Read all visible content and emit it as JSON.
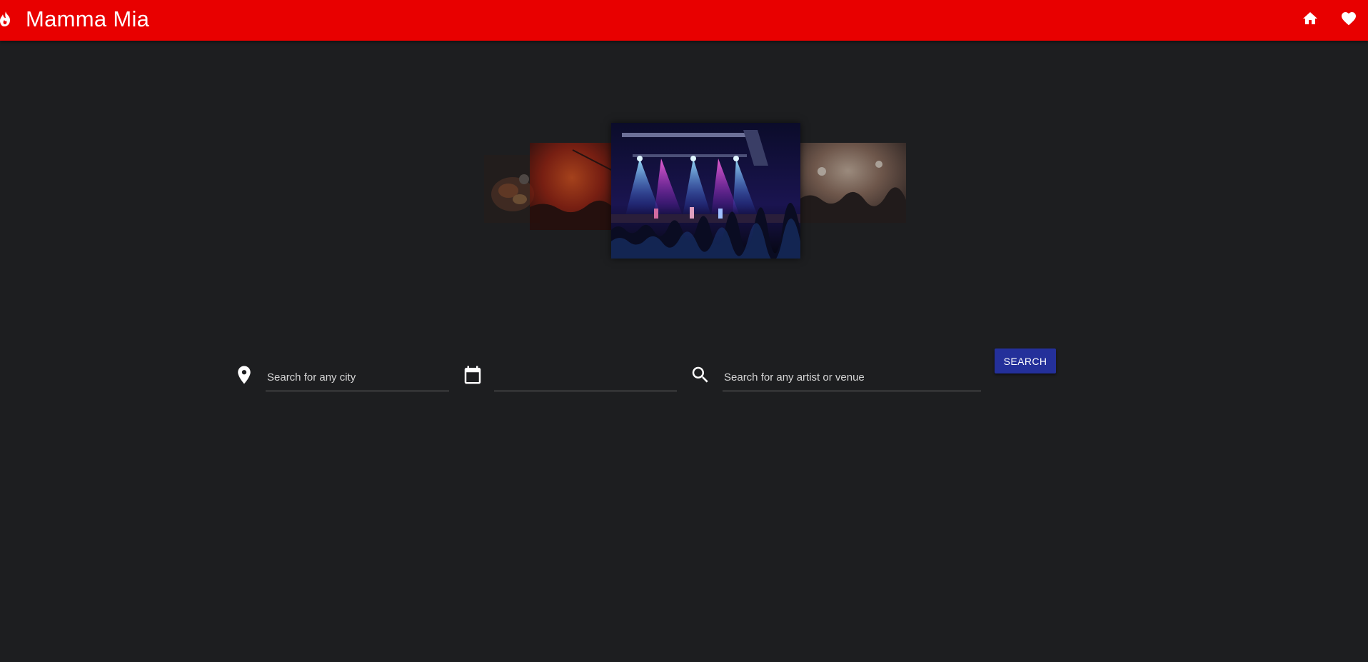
{
  "app": {
    "title": "Mamma Mia",
    "logo_icon": "flame-icon",
    "brand_color": "#e80000",
    "background_color": "#1d1e20"
  },
  "toolbar": {
    "home_icon": "home-icon",
    "favorites_icon": "heart-icon"
  },
  "carousel": {
    "slides": [
      {
        "name": "slide-food-plate",
        "depicts": "dim food photo"
      },
      {
        "name": "slide-red-crowd",
        "depicts": "red-lit concert crowd"
      },
      {
        "name": "slide-concert-stage",
        "depicts": "stage with blue and pink spotlights and audience"
      },
      {
        "name": "slide-hazy-crowd",
        "depicts": "hazy warm-lit crowd"
      }
    ],
    "active_index": 2
  },
  "search": {
    "city": {
      "icon": "location-pin-icon",
      "placeholder": "Search for any city",
      "value": ""
    },
    "date": {
      "icon": "calendar-icon",
      "placeholder": "",
      "value": ""
    },
    "query": {
      "icon": "search-icon",
      "placeholder": "Search for any artist or venue",
      "value": ""
    },
    "button_label": "SEARCH",
    "button_color": "#24309a"
  }
}
